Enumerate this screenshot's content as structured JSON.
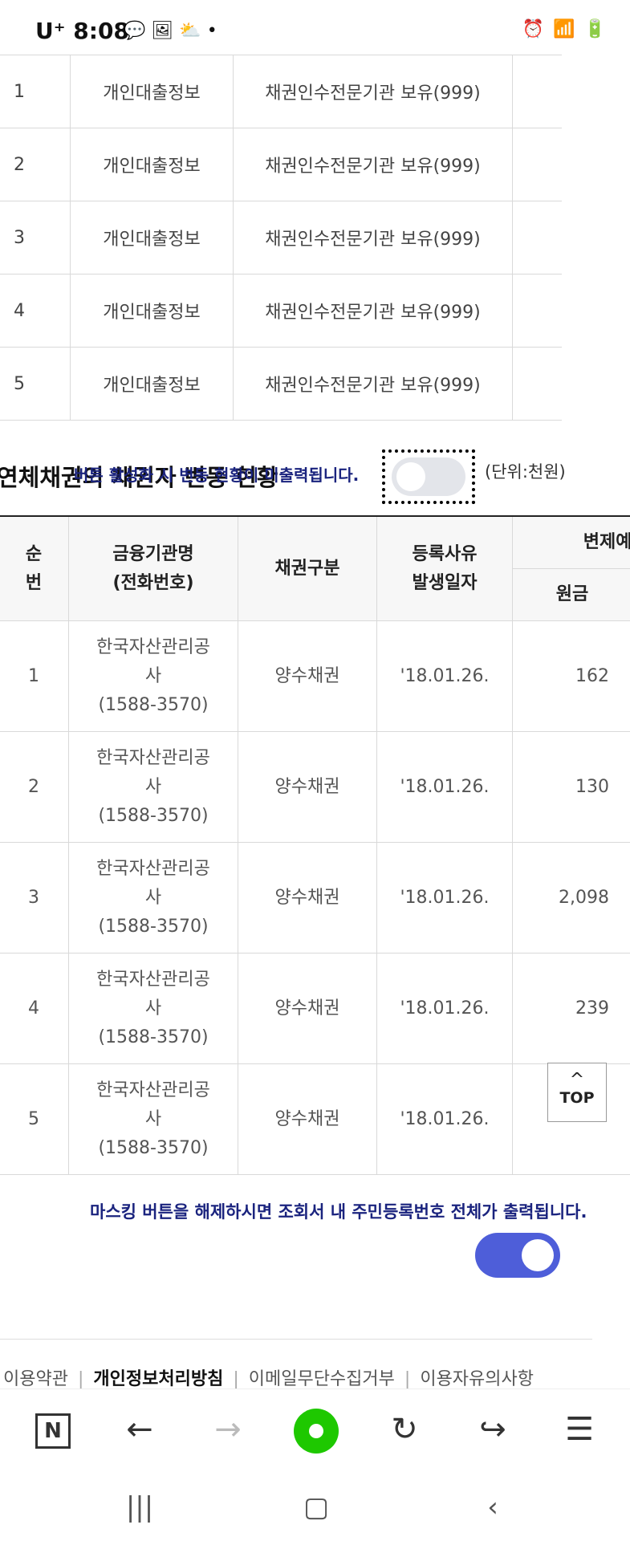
{
  "status_bar": {
    "carrier": "U⁺ 8:08",
    "left_icons": "💬 🖼 ⛅ •",
    "right_icons": "⏰ 📶 🔋"
  },
  "top_table": {
    "rows": [
      {
        "no": "1",
        "type": "개인대출정보",
        "holder": "채권인수전문기관 보유(999)"
      },
      {
        "no": "2",
        "type": "개인대출정보",
        "holder": "채권인수전문기관 보유(999)"
      },
      {
        "no": "3",
        "type": "개인대출정보",
        "holder": "채권인수전문기관 보유(999)"
      },
      {
        "no": "4",
        "type": "개인대출정보",
        "holder": "채권인수전문기관 보유(999)"
      },
      {
        "no": "5",
        "type": "개인대출정보",
        "holder": "채권인수전문기관 보유(999)"
      }
    ]
  },
  "section": {
    "title": "연체채권의 채권자 변동 현황",
    "overlay_note": "버튼 활성화 시 변동 현황이 미출력됩니다.",
    "unit": "(단위:천원)",
    "toggle_state": "off"
  },
  "main_table": {
    "headers": {
      "no": "순\n번",
      "institution": "금융기관명\n(전화번호)",
      "bond_type": "채권구분",
      "date": "등록사유\n발생일자",
      "repay_group": "변제예",
      "principal": "원금"
    },
    "rows": [
      {
        "no": "1",
        "name": "한국자산관리공사",
        "phone": "(1588-3570)",
        "bond_type": "양수채권",
        "date": "'18.01.26.",
        "principal": "162"
      },
      {
        "no": "2",
        "name": "한국자산관리공사",
        "phone": "(1588-3570)",
        "bond_type": "양수채권",
        "date": "'18.01.26.",
        "principal": "130"
      },
      {
        "no": "3",
        "name": "한국자산관리공사",
        "phone": "(1588-3570)",
        "bond_type": "양수채권",
        "date": "'18.01.26.",
        "principal": "2,098"
      },
      {
        "no": "4",
        "name": "한국자산관리공사",
        "phone": "(1588-3570)",
        "bond_type": "양수채권",
        "date": "'18.01.26.",
        "principal": "239"
      },
      {
        "no": "5",
        "name": "한국자산관리공사",
        "phone": "(1588-3570)",
        "bond_type": "양수채권",
        "date": "'18.01.26.",
        "principal": ""
      }
    ]
  },
  "top_button": {
    "label": "TOP",
    "arrow": "^"
  },
  "mask_note": "마스킹 버튼을 해제하시면 조회서 내 주민등록번호 전체가 출력됩니다.",
  "mask_toggle_state": "on",
  "footer": {
    "links": [
      "이용약관",
      "개인정보처리방침",
      "이메일무단수집거부",
      "이용자유의사항"
    ]
  },
  "toolbar": {
    "n_label": "N",
    "back": "←",
    "forward": "→",
    "reload": "↻",
    "share": "↪",
    "menu": "☰"
  },
  "android_nav": {
    "recent": "|||",
    "home": "▢",
    "back": "‹"
  },
  "colors": {
    "accent": "#4e5ed9",
    "note": "#1a237e",
    "home_green": "#1ec800"
  }
}
